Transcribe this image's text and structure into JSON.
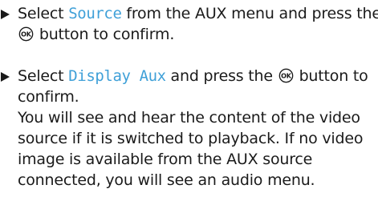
{
  "steps": [
    {
      "prefix": "Select ",
      "term": "Source",
      "middle": " from the AUX menu and press the ",
      "button_label": "OK",
      "suffix": " button to confirm."
    },
    {
      "prefix": "Select ",
      "term": "Display Aux",
      "middle": " and press the ",
      "button_label": "OK",
      "suffix": " button to confirm.",
      "result": "You will see and hear the content of the video source if it is switched to playback. If no video image is available from the AUX source connected, you will see an audio menu."
    }
  ]
}
